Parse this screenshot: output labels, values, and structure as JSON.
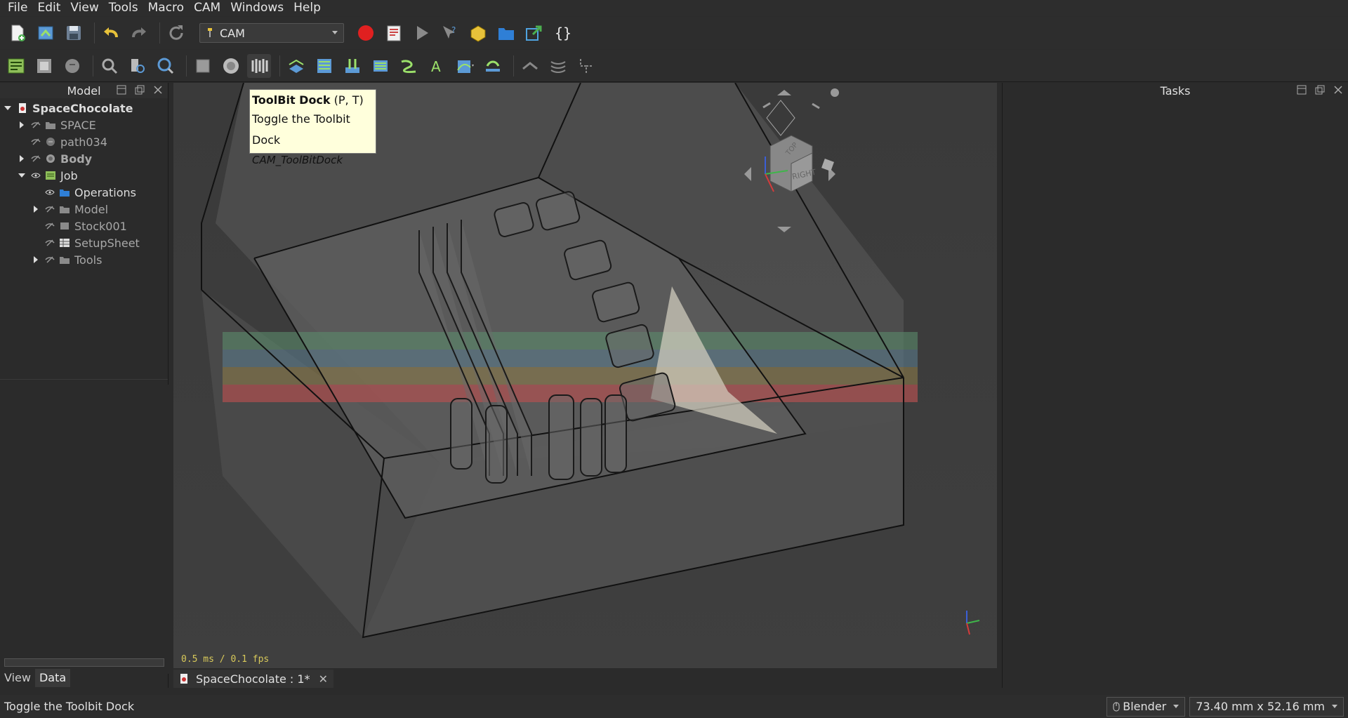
{
  "menubar": {
    "items": [
      "File",
      "Edit",
      "View",
      "Tools",
      "Macro",
      "CAM",
      "Windows",
      "Help"
    ]
  },
  "toolbar": {
    "workbench": "CAM"
  },
  "model_panel": {
    "title": "Model",
    "tree": [
      {
        "label": "SpaceChocolate"
      },
      {
        "label": "SPACE"
      },
      {
        "label": "path034"
      },
      {
        "label": "Body"
      },
      {
        "label": "Job"
      },
      {
        "label": "Operations"
      },
      {
        "label": "Model"
      },
      {
        "label": "Stock001"
      },
      {
        "label": "SetupSheet"
      },
      {
        "label": "Tools"
      }
    ],
    "tabs": [
      "View",
      "Data"
    ]
  },
  "tooltip": {
    "title": "ToolBit Dock",
    "shortcut": "(P, T)",
    "description": "Toggle the Toolbit Dock",
    "command": "CAM_ToolBitDock"
  },
  "viewport": {
    "fps": "0.5 ms / 0.1 fps",
    "navcube_face": "RIGHT",
    "navcube_top": "TOP"
  },
  "document_tab": {
    "label": "SpaceChocolate : 1*"
  },
  "tasks_panel": {
    "title": "Tasks"
  },
  "statusbar": {
    "message": "Toggle the Toolbit Dock",
    "nav_style": "Blender",
    "dimensions": "73.40 mm x 52.16 mm"
  },
  "colors": {
    "accent_yellow": "#d8c95a",
    "record_red": "#e02020",
    "tooltip_bg": "#ffffdc"
  }
}
